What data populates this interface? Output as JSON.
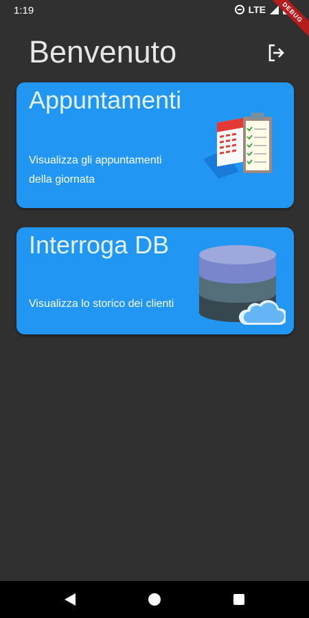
{
  "status_bar": {
    "time": "1:19",
    "network": "LTE",
    "debug_label": "DEBUG"
  },
  "header": {
    "title": "Benvenuto",
    "logout_icon": "logout-icon"
  },
  "cards": [
    {
      "title": "Appuntamenti",
      "description": "Visualizza gli appuntamenti della giornata",
      "icon": "calendar-checklist-icon"
    },
    {
      "title": "Interroga DB",
      "description": "Visualizza lo storico dei clienti",
      "icon": "database-cloud-icon"
    }
  ],
  "navigation": {
    "back_icon": "back-icon",
    "home_icon": "home-icon",
    "recents_icon": "recents-icon"
  },
  "colors": {
    "background": "#303030",
    "card": "#2196f3",
    "nav_bar": "#000000"
  }
}
